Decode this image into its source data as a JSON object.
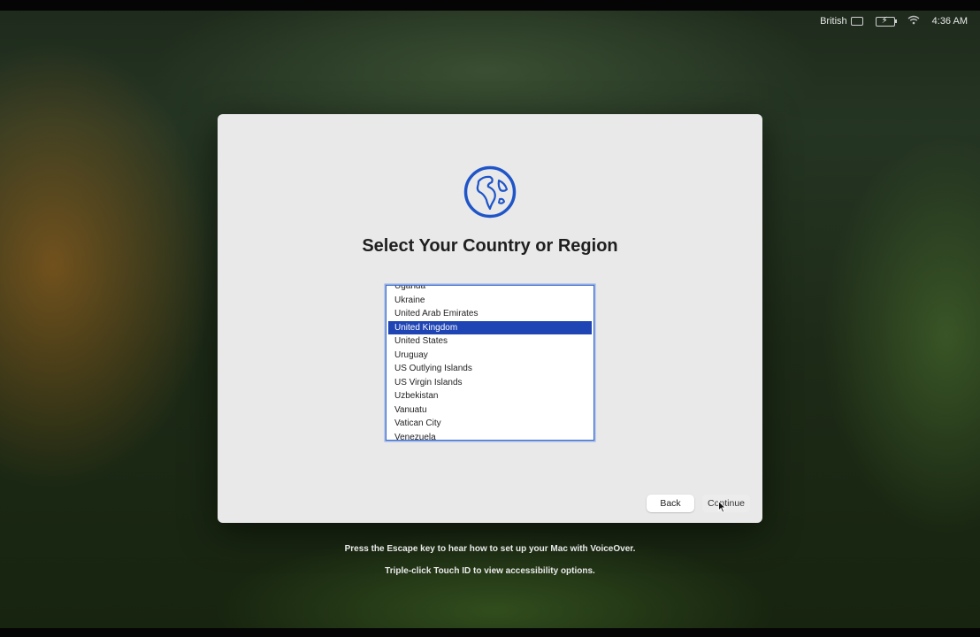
{
  "menubar": {
    "input_source": "British",
    "time": "4:36 AM",
    "icons": [
      "keyboard-icon",
      "battery-charging-icon",
      "wifi-icon"
    ]
  },
  "dialog": {
    "icon": "globe-icon",
    "accent_color": "#1f55c8",
    "title": "Select Your Country or Region",
    "countries": [
      "Uganda",
      "Ukraine",
      "United Arab Emirates",
      "United Kingdom",
      "United States",
      "Uruguay",
      "US Outlying Islands",
      "US Virgin Islands",
      "Uzbekistan",
      "Vanuatu",
      "Vatican City",
      "Venezuela"
    ],
    "selected": "United Kingdom",
    "selected_color": "#1f44b4",
    "buttons": {
      "back": "Back",
      "continue": "Continue"
    }
  },
  "hints": {
    "voiceover": "Press the Escape key to hear how to set up your Mac with VoiceOver.",
    "accessibility": "Triple-click Touch ID to view accessibility options."
  }
}
